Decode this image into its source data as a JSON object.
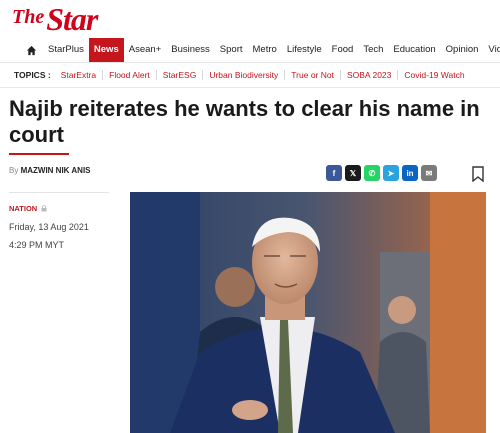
{
  "site": {
    "logo_the": "The",
    "logo_star": "Star"
  },
  "nav": {
    "items": [
      "StarPlus",
      "News",
      "Asean+",
      "Business",
      "Sport",
      "Metro",
      "Lifestyle",
      "Food",
      "Tech",
      "Education",
      "Opinion",
      "Videos"
    ],
    "active": "News"
  },
  "topics": {
    "label": "TOPICS :",
    "items": [
      "StarExtra",
      "Flood Alert",
      "StarESG",
      "Urban Biodiversity",
      "True or Not",
      "SOBA 2023",
      "Covid-19 Watch"
    ]
  },
  "article": {
    "headline": "Najib reiterates he wants to clear his name in court",
    "byline_prefix": "By",
    "author": "MAZWIN NIK ANIS",
    "section": "NATION",
    "date": "Friday, 13 Aug 2021",
    "time": "4:29 PM MYT"
  },
  "share": [
    {
      "name": "facebook-icon",
      "glyph": "f",
      "color": "#3b5998"
    },
    {
      "name": "x-icon",
      "glyph": "𝕏",
      "color": "#1a1a1a"
    },
    {
      "name": "whatsapp-icon",
      "glyph": "✆",
      "color": "#25d366"
    },
    {
      "name": "telegram-icon",
      "glyph": "➤",
      "color": "#2aa3de"
    },
    {
      "name": "linkedin-icon",
      "glyph": "in",
      "color": "#0a66c2"
    },
    {
      "name": "email-icon",
      "glyph": "✉",
      "color": "#7a7a7a"
    }
  ],
  "colors": {
    "brand": "#d0021b",
    "nav_active": "#c4161c",
    "topic": "#c4161c"
  }
}
